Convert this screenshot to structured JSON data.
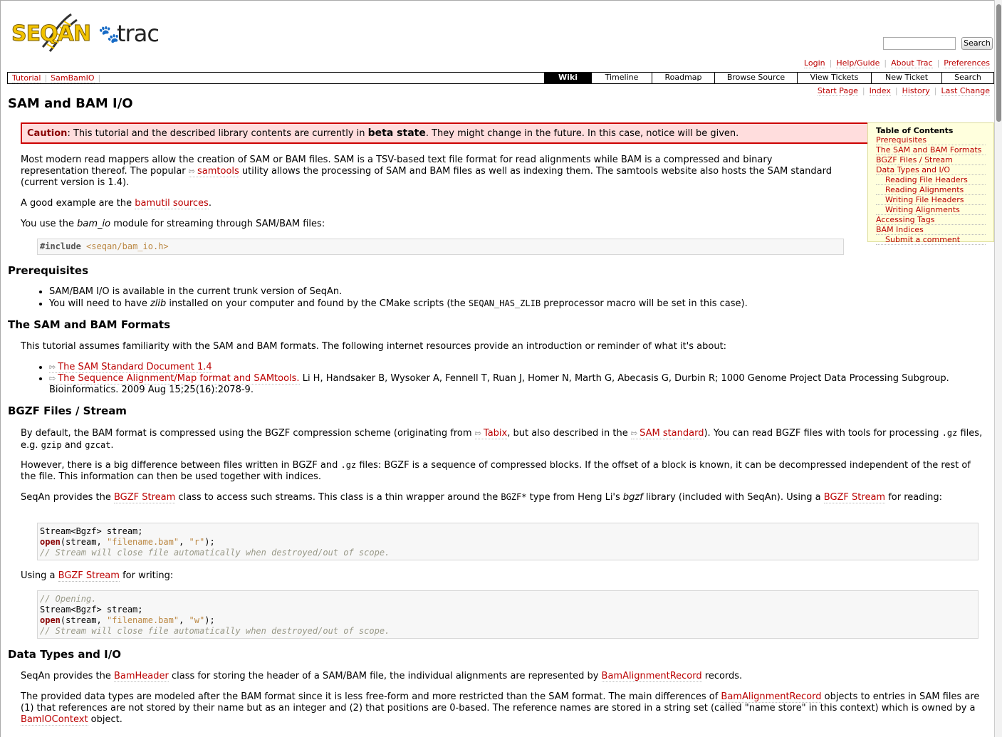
{
  "logo": {
    "seqan": "SEQAN",
    "trac": "trac"
  },
  "search": {
    "placeholder": "",
    "button": "Search"
  },
  "metanav": [
    "Login",
    "Help/Guide",
    "About Trac",
    "Preferences"
  ],
  "breadcrumbs": [
    "Tutorial",
    "SamBamIO"
  ],
  "mainnav": [
    "Wiki",
    "Timeline",
    "Roadmap",
    "Browse Source",
    "View Tickets",
    "New Ticket",
    "Search"
  ],
  "ctxnav": [
    "Start Page",
    "Index",
    "History",
    "Last Change"
  ],
  "page_title": "SAM and BAM I/O",
  "caution": {
    "label": "Caution",
    "pre": ": This tutorial and the described library contents are currently in ",
    "beta": "beta state",
    "post": ". They might change in the future. In this case, notice will be given."
  },
  "toc": {
    "title": "Table of Contents",
    "items": [
      "Prerequisites",
      "The SAM and BAM Formats",
      "BGZF Files / Stream",
      "Data Types and I/O",
      "Reading File Headers",
      "Reading Alignments",
      "Writing File Headers",
      "Writing Alignments",
      "Accessing Tags",
      "BAM Indices",
      "Submit a comment"
    ]
  },
  "intro": {
    "p1a": "Most modern read mappers allow the creation of SAM or BAM files. SAM is a TSV-based text file format for read alignments while BAM is a compressed and binary representation thereof. The popular ",
    "samtools": "samtools",
    "p1b": " utility allows the processing of SAM and BAM files as well as indexing them. The samtools website also hosts the SAM standard (current version is 1.4).",
    "p2a": "A good example are the ",
    "bamutil": "bamutil sources",
    "p2b": ".",
    "p3a": "You use the ",
    "p3em": "bam_io",
    "p3b": " module for streaming through SAM/BAM files:",
    "code_hash": "#",
    "code_include": "include",
    "code_header": "<seqan/bam_io.h>"
  },
  "prereq": {
    "title": "Prerequisites",
    "item1": "SAM/BAM I/O is available in the current trunk version of SeqAn.",
    "item2a": "You will need to have ",
    "item2em": "zlib",
    "item2b": " installed on your computer and found by the CMake scripts (the ",
    "item2code": "SEQAN_HAS_ZLIB",
    "item2c": " preprocessor macro will be set in this case)."
  },
  "formats": {
    "title": "The SAM and BAM Formats",
    "p": "This tutorial assumes familiarity with the SAM and BAM formats. The following internet resources provide an introduction or reminder of what it's about:",
    "link1": "The SAM Standard Document 1.4",
    "link2": "The Sequence Alignment/Map format and SAMtools.",
    "ref": " Li H, Handsaker B, Wysoker A, Fennell T, Ruan J, Homer N, Marth G, Abecasis G, Durbin R; 1000 Genome Project Data Processing Subgroup. Bioinformatics. 2009 Aug 15;25(16):2078-9."
  },
  "bgzf": {
    "title": "BGZF Files / Stream",
    "p1a": "By default, the BAM format is compressed using the BGZF compression scheme (originating from ",
    "tabix": "Tabix",
    "p1b": ", but also described in the ",
    "samstd": "SAM standard",
    "p1c": "). You can read BGZF files with tools for processing ",
    "gz": ".gz",
    "p1d": " files, e.g. ",
    "gzip": "gzip",
    "p1e": " and ",
    "gzcat": "gzcat",
    "p1f": ".",
    "p2a": "However, there is a big difference between files written in BGZF and ",
    "p2gz": ".gz",
    "p2b": " files: BGZF is a sequence of compressed blocks. If the offset of a block is known, it can be decompressed independent of the rest of the file. This information can then be used together with indices.",
    "p3a": "SeqAn provides the ",
    "bgzfstream": "BGZF Stream",
    "p3b": " class to access such streams. This class is a thin wrapper around the ",
    "bgzfstar": "BGZF*",
    "p3c": " type from Heng Li's ",
    "p3em": "bgzf",
    "p3d": " library (included with SeqAn). Using a ",
    "p3e": " for reading:",
    "p4a": "Using a ",
    "p4b": " for writing:",
    "code1_l1": "Stream<Bgzf> stream;",
    "code_open": "open",
    "code_open_a": "(stream, ",
    "code1_file": "\"filename.bam\"",
    "code_comma": ", ",
    "code1_mode": "\"r\"",
    "code_close": ");",
    "code_cmt_scope": "// Stream will close file automatically when destroyed/out of scope.",
    "code2_cmt": "// Opening.",
    "code2_mode": "\"w\""
  },
  "datatypes": {
    "title": "Data Types and I/O",
    "p1a": "SeqAn provides the ",
    "bamheader": "BamHeader",
    "p1b": " class for storing the header of a SAM/BAM file, the individual alignments are represented by ",
    "bamrecord": "BamAlignmentRecord",
    "p1c": " records.",
    "p2a": "The provided data types are modeled after the BAM format since it is less free-form and more restricted than the SAM format. The main differences of ",
    "p2b": " objects to entries in SAM files are (1) that references are not stored by their name but as an integer and (2) that positions are 0-based. The reference names are stored in a string set (called \"name store\" in this context) which is owned by a ",
    "bamioctx": "BamIOContext",
    "p2c": " object."
  }
}
